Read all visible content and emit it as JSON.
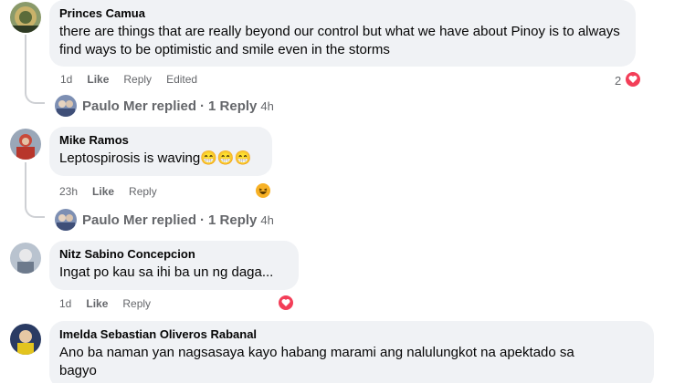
{
  "comments": [
    {
      "author": "Princes Camua",
      "text": "there are things that are really beyond our control but what we have about Pinoy is to always find ways to be optimistic and smile even in the storms",
      "time": "1d",
      "like": "Like",
      "reply": "Reply",
      "edited": "Edited",
      "reaction_count": "2",
      "reaction": "heart",
      "replied": {
        "name_text": "Paulo Mer replied",
        "sep": "·",
        "count_text": "1 Reply",
        "time": "4h"
      }
    },
    {
      "author": "Mike Ramos",
      "text": "Leptospirosis is waving😁😁😁",
      "time": "23h",
      "like": "Like",
      "reply": "Reply",
      "reaction": "haha",
      "replied": {
        "name_text": "Paulo Mer replied",
        "sep": "·",
        "count_text": "1 Reply",
        "time": "4h"
      }
    },
    {
      "author": "Nitz Sabino Concepcion",
      "text": "Ingat po kau sa ihi ba un ng daga...",
      "time": "1d",
      "like": "Like",
      "reply": "Reply",
      "reaction": "heart"
    },
    {
      "author": "Imelda Sebastian Oliveros Rabanal",
      "text_line1": "Ano ba naman yan nagsasaya kayo habang marami ang nalulungkot na apektado sa",
      "text_line2": "bagyo"
    }
  ],
  "colors": {
    "bubble": "#f0f2f5",
    "meta": "#65676b",
    "heart": "#f33e58",
    "haha": "#f7b125",
    "thread": "#ced0d4"
  }
}
